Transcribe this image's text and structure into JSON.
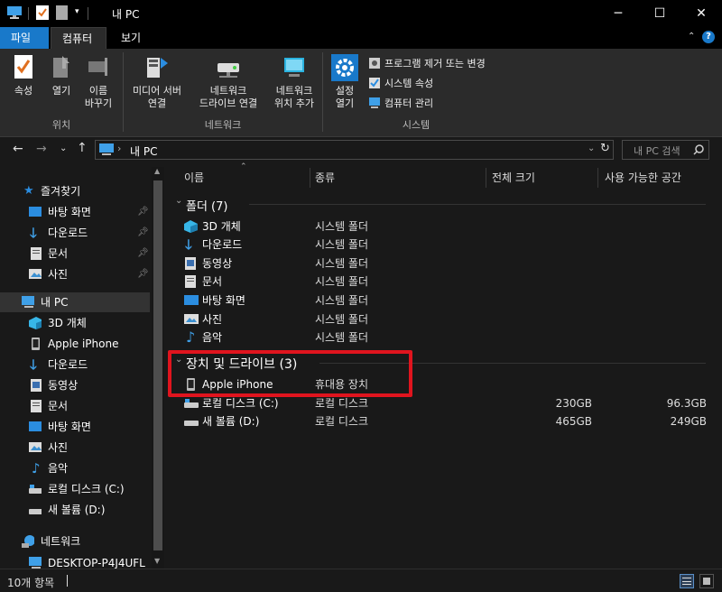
{
  "window": {
    "title": "내 PC"
  },
  "tabs": [
    "파일",
    "컴퓨터",
    "보기"
  ],
  "ribbon": {
    "location": {
      "properties": "속성",
      "open": "열기",
      "rename": "이름\n바꾸기",
      "group": "위치"
    },
    "network": {
      "media_server": "미디어 서버\n연결",
      "map_drive": "네트워크\n드라이브 연결",
      "add_location": "네트워크\n위치 추가",
      "group": "네트워크"
    },
    "system": {
      "settings": "설정\n열기",
      "uninstall": "프로그램 제거 또는 변경",
      "sys_props": "시스템 속성",
      "manage": "컴퓨터 관리",
      "group": "시스템"
    }
  },
  "address": {
    "path": "내 PC",
    "search_placeholder": "내 PC 검색"
  },
  "nav": {
    "quick_access": "즐겨찾기",
    "quick_items": [
      "바탕 화면",
      "다운로드",
      "문서",
      "사진"
    ],
    "this_pc": "내 PC",
    "pc_items": [
      "3D 개체",
      "Apple iPhone",
      "다운로드",
      "동영상",
      "문서",
      "바탕 화면",
      "사진",
      "음악",
      "로컬 디스크 (C:)",
      "새 볼륨 (D:)"
    ],
    "network": "네트워크",
    "network_items": [
      "DESKTOP-P4J4UFL"
    ]
  },
  "columns": {
    "name": "이름",
    "type": "종류",
    "total": "전체 크기",
    "free": "사용 가능한 공간"
  },
  "folders": {
    "header": "폴더 (7)",
    "items": [
      {
        "name": "3D 개체",
        "type": "시스템 폴더"
      },
      {
        "name": "다운로드",
        "type": "시스템 폴더"
      },
      {
        "name": "동영상",
        "type": "시스템 폴더"
      },
      {
        "name": "문서",
        "type": "시스템 폴더"
      },
      {
        "name": "바탕 화면",
        "type": "시스템 폴더"
      },
      {
        "name": "사진",
        "type": "시스템 폴더"
      },
      {
        "name": "음악",
        "type": "시스템 폴더"
      }
    ]
  },
  "devices": {
    "header": "장치 및 드라이브 (3)",
    "items": [
      {
        "name": "Apple iPhone",
        "type": "휴대용 장치",
        "total": "",
        "free": ""
      },
      {
        "name": "로컬 디스크 (C:)",
        "type": "로컬 디스크",
        "total": "230GB",
        "free": "96.3GB"
      },
      {
        "name": "새 볼륨 (D:)",
        "type": "로컬 디스크",
        "total": "465GB",
        "free": "249GB"
      }
    ]
  },
  "status": {
    "count": "10개 항목"
  },
  "colors": {
    "highlight": "#e0141e",
    "accent": "#1979ca"
  }
}
